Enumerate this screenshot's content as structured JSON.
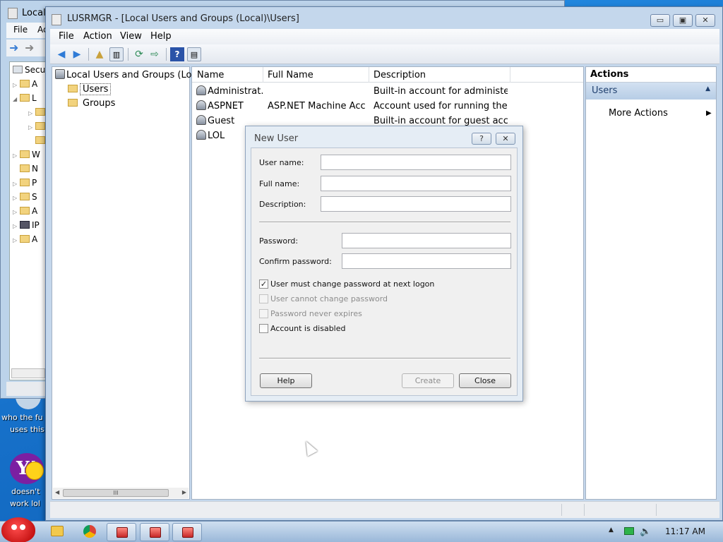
{
  "background_window": {
    "title": "Local",
    "menu": [
      "File",
      "Ac"
    ],
    "tree": [
      {
        "label": "Secu",
        "icon": "computer-icon"
      },
      {
        "label": "A",
        "icon": "lock-folder-icon"
      },
      {
        "label": "L",
        "icon": "lock-folder-icon"
      },
      {
        "label": "",
        "icon": "folder-icon"
      },
      {
        "label": "",
        "icon": "folder-icon"
      },
      {
        "label": "",
        "icon": "folder-icon"
      },
      {
        "label": "W",
        "icon": "folder-icon"
      },
      {
        "label": "N",
        "icon": "folder-icon"
      },
      {
        "label": "P",
        "icon": "folder-icon"
      },
      {
        "label": "S",
        "icon": "folder-icon"
      },
      {
        "label": "A",
        "icon": "folder-icon"
      },
      {
        "label": "IP",
        "icon": "network-icon"
      },
      {
        "label": "A",
        "icon": "folder-icon"
      }
    ]
  },
  "desktop": {
    "text1": "who the fu",
    "text2": "uses this",
    "text3": "doesn't",
    "text4": "work lol"
  },
  "main_window": {
    "title": "LUSRMGR - [Local Users and Groups (Local)\\Users]",
    "caption_buttons": {
      "minimize": "▭",
      "maximize": "▣",
      "close": "✕"
    },
    "menu": {
      "file": "File",
      "action": "Action",
      "view": "View",
      "help": "Help"
    },
    "tree": {
      "root": "Local Users and Groups (Loca",
      "users": "Users",
      "groups": "Groups"
    },
    "list": {
      "headers": {
        "name": "Name",
        "full_name": "Full Name",
        "description": "Description"
      },
      "rows": [
        {
          "name": "Administrat...",
          "full_name": "",
          "description": "Built-in account for administeri..."
        },
        {
          "name": "ASPNET",
          "full_name": "ASP.NET Machine Acc...",
          "description": "Account used for running the ..."
        },
        {
          "name": "Guest",
          "full_name": "",
          "description": "Built-in account for guest acce..."
        },
        {
          "name": "LOL",
          "full_name": "",
          "description": ""
        }
      ]
    },
    "actions": {
      "header": "Actions",
      "section": "Users",
      "more": "More Actions"
    },
    "hscroll_grip": "III"
  },
  "dialog": {
    "title": "New User",
    "help_btn": "?",
    "close_btn": "✕",
    "labels": {
      "user_name": "User name:",
      "full_name": "Full name:",
      "description": "Description:",
      "password": "Password:",
      "confirm_password": "Confirm password:"
    },
    "values": {
      "user_name": "",
      "full_name": "",
      "description": "",
      "password": "",
      "confirm_password": ""
    },
    "checkboxes": {
      "must_change": {
        "label": "User must change password at next logon",
        "checked": true,
        "enabled": true
      },
      "cannot_change": {
        "label": "User cannot change password",
        "checked": false,
        "enabled": false
      },
      "never_expires": {
        "label": "Password never expires",
        "checked": false,
        "enabled": false
      },
      "disabled": {
        "label": "Account is disabled",
        "checked": false,
        "enabled": true
      }
    },
    "buttons": {
      "help": "Help",
      "create": "Create",
      "close": "Close"
    },
    "check_mark": "✓"
  },
  "taskbar": {
    "clock": "11:17 AM",
    "pinned": [
      "folder-icon",
      "chrome-icon"
    ],
    "tray": [
      "flag-icon",
      "network-icon",
      "volume-icon"
    ]
  }
}
